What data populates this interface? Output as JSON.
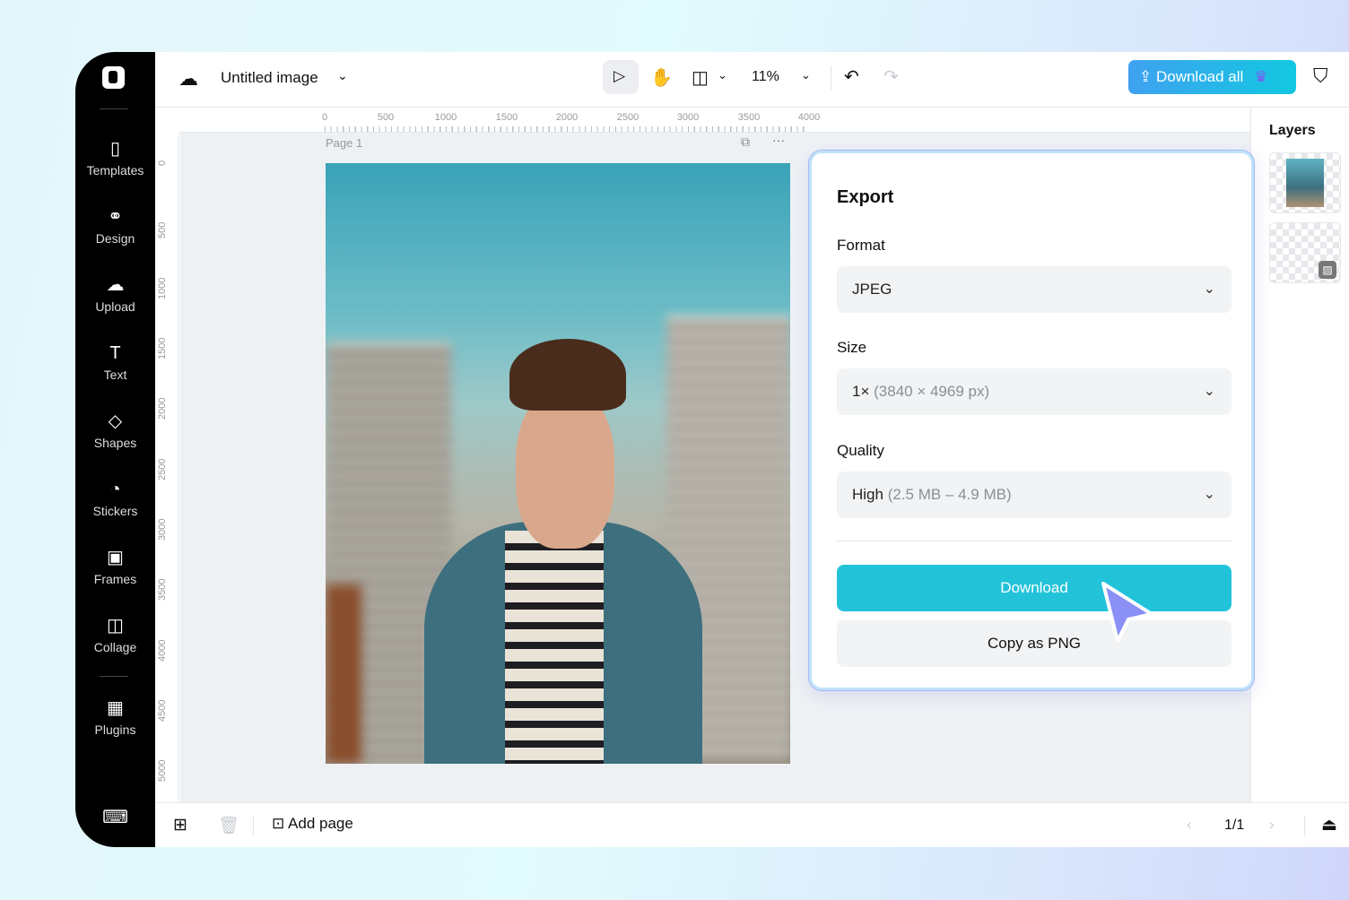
{
  "app": {
    "title": "Untitled image",
    "zoom": "11%",
    "download_all": "Download all",
    "page_label": "Page 1"
  },
  "sidebar": {
    "items": [
      {
        "label": "Templates",
        "icon": "templates-icon"
      },
      {
        "label": "Design",
        "icon": "design-icon"
      },
      {
        "label": "Upload",
        "icon": "upload-cloud-icon"
      },
      {
        "label": "Text",
        "icon": "text-icon"
      },
      {
        "label": "Shapes",
        "icon": "shapes-icon"
      },
      {
        "label": "Stickers",
        "icon": "stickers-icon"
      },
      {
        "label": "Frames",
        "icon": "frames-icon"
      },
      {
        "label": "Collage",
        "icon": "collage-icon"
      },
      {
        "label": "Plugins",
        "icon": "plugins-icon"
      }
    ]
  },
  "ruler": {
    "h": [
      "0",
      "500",
      "1000",
      "1500",
      "2000",
      "2500",
      "3000",
      "3500",
      "4000"
    ],
    "v": [
      "0",
      "500",
      "1000",
      "1500",
      "2000",
      "2500",
      "3000",
      "3500",
      "4000",
      "4500",
      "5000"
    ]
  },
  "layers": {
    "title": "Layers"
  },
  "export": {
    "title": "Export",
    "format_label": "Format",
    "format_value": "JPEG",
    "size_label": "Size",
    "size_value": "1×",
    "size_meta": "(3840 × 4969 px)",
    "quality_label": "Quality",
    "quality_value": "High",
    "quality_meta": "(2.5 MB – 4.9 MB)",
    "download": "Download",
    "copy": "Copy as PNG"
  },
  "bottom": {
    "add_page": "Add page",
    "page_count": "1/1"
  },
  "colors": {
    "accent": "#22c3d9",
    "download_all_start": "#3fa2f0",
    "download_all_end": "#12c8e0",
    "cursor": "#8a90f5"
  }
}
